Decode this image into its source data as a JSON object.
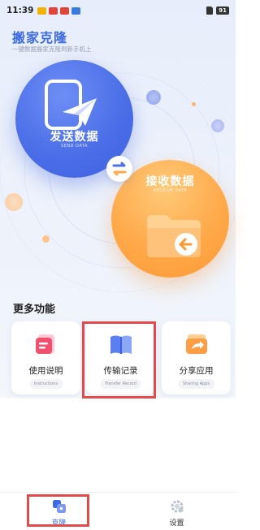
{
  "status_bar": {
    "time": "11:39",
    "battery": "91"
  },
  "header": {
    "title": "搬家克隆",
    "subtitle": "一键数据搬家克隆到新手机上"
  },
  "send": {
    "label": "发送数据",
    "sub": "SEND DATA",
    "color": "#4c6fe8"
  },
  "receive": {
    "label": "接收数据",
    "sub": "RECEIVE DATA",
    "color": "#ffa94a"
  },
  "more": {
    "title": "更多功能",
    "cards": [
      {
        "label": "使用说明",
        "sub": "Instructions",
        "icon": "instructions-icon"
      },
      {
        "label": "传输记录",
        "sub": "Transfer Record",
        "icon": "transfer-record-icon"
      },
      {
        "label": "分享应用",
        "sub": "Sharing Apps",
        "icon": "share-apps-icon"
      }
    ]
  },
  "nav": {
    "items": [
      {
        "label": "克隆",
        "icon": "clone-icon",
        "active": true
      },
      {
        "label": "设置",
        "icon": "gear-icon",
        "active": false
      }
    ]
  },
  "colors": {
    "accent": "#3d6ae5",
    "highlight": "#e24b4b"
  }
}
